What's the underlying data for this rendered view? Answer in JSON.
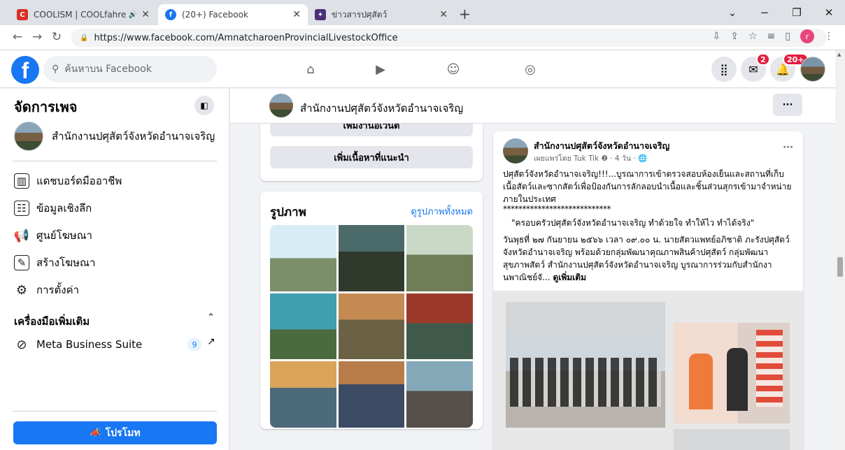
{
  "browser": {
    "tabs": [
      {
        "title": "COOLISM | COOLfahrenheit",
        "favicon": "coolism-favicon",
        "audio": "🔊"
      },
      {
        "title": "(20+) Facebook",
        "favicon": "facebook-favicon"
      },
      {
        "title": "ข่าวสารปศุสัตว์",
        "favicon": "news-favicon"
      }
    ],
    "url": "https://www.facebook.com/AmnatcharoenProvincialLivestockOffice",
    "profile_initial": "r"
  },
  "fb": {
    "search_placeholder": "ค้นหาบน Facebook",
    "messenger_badge": "2",
    "notifications_badge": "20+"
  },
  "sidebar": {
    "title": "จัดการเพจ",
    "page_name": "สำนักงานปศุสัตว์จังหวัดอำนาจเจริญ",
    "items": [
      {
        "label": "แดชบอร์ดมืออาชีพ",
        "icon": "dashboard-icon"
      },
      {
        "label": "ข้อมูลเชิงลึก",
        "icon": "insights-icon"
      },
      {
        "label": "ศูนย์โฆษณา",
        "icon": "megaphone-icon"
      },
      {
        "label": "สร้างโฆษณา",
        "icon": "edit-icon"
      },
      {
        "label": "การตั้งค่า",
        "icon": "gear-icon"
      }
    ],
    "more_tools_title": "เครื่องมือเพิ่มเติม",
    "meta_suite": {
      "label": "Meta Business Suite",
      "count": "9"
    },
    "promote_label": "โปรโมท"
  },
  "page_header": {
    "name": "สำนักงานปศุสัตว์จังหวัดอำนาจเจริญ",
    "more_label": "···"
  },
  "left_column": {
    "cut_button_label": "เพิ่มงานอีเวนต์",
    "suggest_button_label": "เพิ่มเนื้อหาที่แนะนำ",
    "photos_title": "รูปภาพ",
    "photos_link": "ดูรูปภาพทั้งหมด"
  },
  "post": {
    "author": "สำนักงานปศุสัตว์จังหวัดอำนาจเจริญ",
    "meta": "เผยแพร่โดย Tuk Tik ❷ · 4 วัน · 🌐",
    "line1": "ปศุสัตว์จังหวัดอำนาจเจริญ!!!...บูรณาการเข้าตรวจสอบห้องเย็นและสถานที่เก็บเนื้อสัตว์และซากสัตว์เพื่อป้องกันการลักลอบนำเนื้อและชิ้นส่วนสุกรเข้ามาจำหน่ายภายในประเทศ",
    "stars": "****************************",
    "quote": "\"ครอบครัวปศุสัตว์จังหวัดอำนาจเจริญ ทำด้วยใจ ทำให้ไว ทำได้จริง\"",
    "body": "วันพุธที่ ๒๗ กันยายน ๒๕๖๖ เวลา ๐๙.๐๐ น. นายสัตวแพทย์อภิชาติ ภะรังปศุสัตว์จังหวัดอำนาจเจริญ พร้อมด้วยกลุ่มพัฒนาคุณภาพสินค้าปศุสัตว์ กลุ่มพัฒนาสุขภาพสัตว์ สำนักงานปศุสัตว์จังหวัดอำนาจเจริญ บูรณาการร่วมกับสำนักงานพาณิชย์จั...",
    "see_more": "ดูเพิ่มเติม",
    "more_label": "···"
  }
}
